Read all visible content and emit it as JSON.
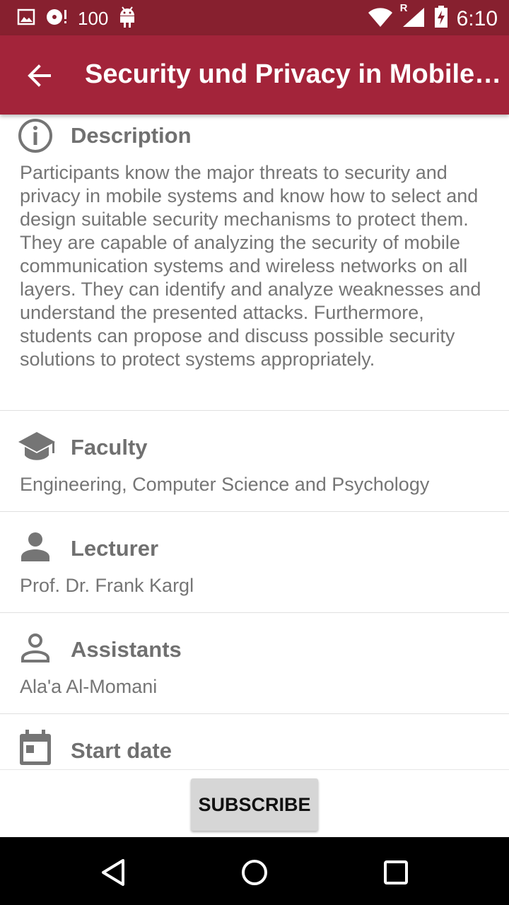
{
  "status_bar": {
    "battery_text": "100",
    "network_label": "R",
    "time": "6:10"
  },
  "app_bar": {
    "title": "Security und Privacy in Mobilen Systemen"
  },
  "sections": {
    "description": {
      "heading": "Description",
      "icon": "info-icon",
      "text": "Participants know the major threats to security and privacy in mobile systems and know how to select and design suitable security mechanisms to protect them. They are capable of analyzing the security of mobile communication systems and wireless networks on all layers. They can identify and analyze weaknesses and understand the presented attacks. Furthermore, students can propose and discuss possible security solutions to protect systems appropriately."
    },
    "faculty": {
      "heading": "Faculty",
      "icon": "school-icon",
      "text": "Engineering, Computer Science and Psychology"
    },
    "lecturer": {
      "heading": "Lecturer",
      "icon": "person-icon",
      "text": "Prof. Dr. Frank Kargl"
    },
    "assistants": {
      "heading": "Assistants",
      "icon": "person-outline-icon",
      "text": "Ala'a Al-Momani"
    },
    "start_date": {
      "heading": "Start date",
      "icon": "calendar-icon"
    }
  },
  "actions": {
    "subscribe_label": "SUBSCRIBE"
  },
  "colors": {
    "status_bar": "#87202f",
    "app_bar": "#a3243a",
    "icon_gray": "#757575"
  }
}
